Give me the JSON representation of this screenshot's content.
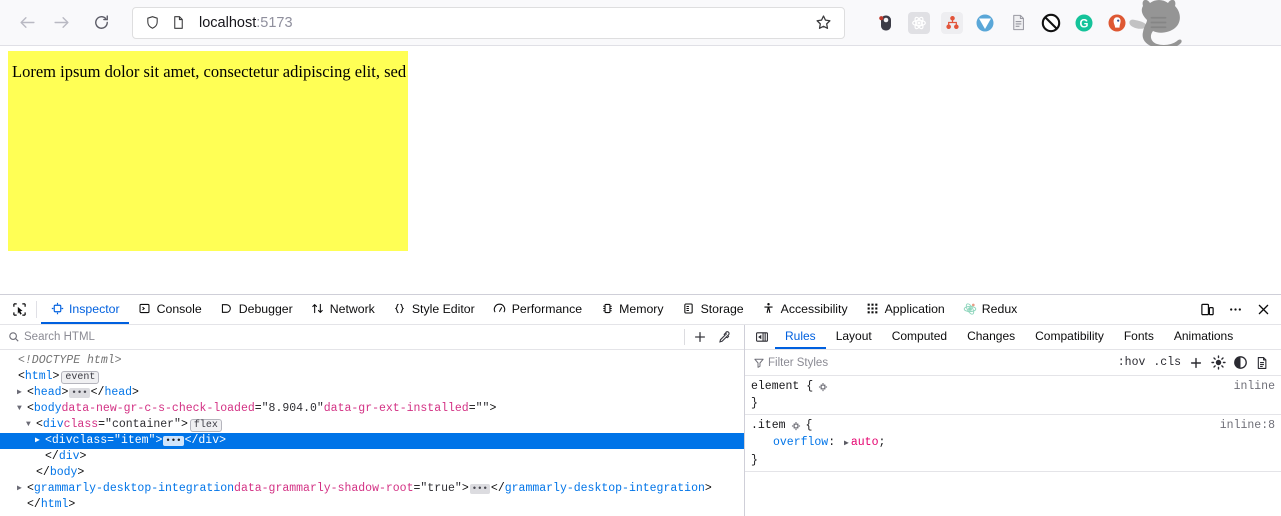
{
  "browser": {
    "nav": {
      "back_icon": "arrow-left-icon",
      "forward_icon": "arrow-right-icon",
      "reload_icon": "reload-icon"
    },
    "urlbar": {
      "shield_icon": "shield-icon",
      "page_icon": "page-icon",
      "url_host": "localhost",
      "url_port": ":5173",
      "full_url": "localhost:5173",
      "bookmark_icon": "star-icon"
    },
    "extensions": [
      {
        "name": "extension-dark-icon",
        "label": ""
      },
      {
        "name": "react-devtools-icon",
        "label": ""
      },
      {
        "name": "sitemap-icon",
        "label": ""
      },
      {
        "name": "vimium-icon",
        "label": ""
      },
      {
        "name": "document-reader-icon",
        "label": ""
      },
      {
        "name": "ublock-origin-icon",
        "label": ""
      },
      {
        "name": "grammarly-icon",
        "label": "G"
      },
      {
        "name": "duckduckgo-privacy-icon",
        "label": ""
      }
    ],
    "menu_icon": "hamburger-menu-icon",
    "cat_overlay": "cat-silhouette-overlay"
  },
  "page": {
    "item_text": "Lorem ipsum dolor sit amet, consectetur adipiscing elit, sed…",
    "container_color": "#ffff55"
  },
  "devtools": {
    "picker_icon": "element-picker-icon",
    "tabs": [
      {
        "label": "Inspector",
        "icon": "inspector-icon",
        "active": true
      },
      {
        "label": "Console",
        "icon": "console-icon",
        "active": false
      },
      {
        "label": "Debugger",
        "icon": "debugger-icon",
        "active": false
      },
      {
        "label": "Network",
        "icon": "network-icon",
        "active": false
      },
      {
        "label": "Style Editor",
        "icon": "style-editor-icon",
        "active": false
      },
      {
        "label": "Performance",
        "icon": "performance-icon",
        "active": false
      },
      {
        "label": "Memory",
        "icon": "memory-icon",
        "active": false
      },
      {
        "label": "Storage",
        "icon": "storage-icon",
        "active": false
      },
      {
        "label": "Accessibility",
        "icon": "accessibility-icon",
        "active": false
      },
      {
        "label": "Application",
        "icon": "application-icon",
        "active": false
      },
      {
        "label": "Redux",
        "icon": "redux-icon",
        "active": false
      }
    ],
    "toolbar_buttons": [
      {
        "name": "responsive-design-mode-icon"
      },
      {
        "name": "devtools-meatball-menu-icon"
      },
      {
        "name": "close-devtools-icon"
      }
    ],
    "markup": {
      "search_placeholder": "Search HTML",
      "search_icon": "search-icon",
      "add_node_icon": "plus-icon",
      "eyedropper_icon": "eyedropper-icon",
      "lines": [
        {
          "id": "doctype",
          "indent": 0,
          "twisty": "none",
          "selected": false,
          "parts": [
            {
              "t": "doctype",
              "s": "<!DOCTYPE html>"
            }
          ]
        },
        {
          "id": "html-open",
          "indent": 0,
          "twisty": "none",
          "selected": false,
          "parts": [
            {
              "t": "punc",
              "s": "<"
            },
            {
              "t": "tag",
              "s": "html"
            },
            {
              "t": "punc",
              "s": ">"
            },
            {
              "t": "badge",
              "s": "event"
            }
          ]
        },
        {
          "id": "head",
          "indent": 1,
          "twisty": "collapsed",
          "selected": false,
          "parts": [
            {
              "t": "punc",
              "s": "<"
            },
            {
              "t": "tag",
              "s": "head"
            },
            {
              "t": "punc",
              "s": ">"
            },
            {
              "t": "ellipsis",
              "s": ""
            },
            {
              "t": "punc",
              "s": "</"
            },
            {
              "t": "tag",
              "s": "head"
            },
            {
              "t": "punc",
              "s": ">"
            }
          ]
        },
        {
          "id": "body-open",
          "indent": 1,
          "twisty": "expanded",
          "selected": false,
          "parts": [
            {
              "t": "punc",
              "s": "<"
            },
            {
              "t": "tag",
              "s": "body"
            },
            {
              "t": "attr",
              "s": " data-new-gr-c-s-check-loaded"
            },
            {
              "t": "punc",
              "s": "="
            },
            {
              "t": "val",
              "s": "\"8.904.0\""
            },
            {
              "t": "attr",
              "s": " data-gr-ext-installed"
            },
            {
              "t": "punc",
              "s": "="
            },
            {
              "t": "val",
              "s": "\"\""
            },
            {
              "t": "punc",
              "s": ">"
            }
          ]
        },
        {
          "id": "container-open",
          "indent": 2,
          "twisty": "expanded",
          "selected": false,
          "parts": [
            {
              "t": "punc",
              "s": "<"
            },
            {
              "t": "tag",
              "s": "div"
            },
            {
              "t": "attr",
              "s": " class"
            },
            {
              "t": "punc",
              "s": "="
            },
            {
              "t": "val",
              "s": "\"container\""
            },
            {
              "t": "punc",
              "s": ">"
            },
            {
              "t": "badge",
              "s": "flex"
            }
          ]
        },
        {
          "id": "item",
          "indent": 3,
          "twisty": "collapsed",
          "selected": true,
          "parts": [
            {
              "t": "punc",
              "s": "<"
            },
            {
              "t": "tag",
              "s": "div"
            },
            {
              "t": "attr",
              "s": " class"
            },
            {
              "t": "punc",
              "s": "="
            },
            {
              "t": "val",
              "s": "\"item\""
            },
            {
              "t": "punc",
              "s": ">"
            },
            {
              "t": "ellipsis",
              "s": ""
            },
            {
              "t": "punc",
              "s": "</"
            },
            {
              "t": "tag",
              "s": "div"
            },
            {
              "t": "punc",
              "s": ">"
            }
          ]
        },
        {
          "id": "container-close",
          "indent": 3,
          "twisty": "none",
          "selected": false,
          "parts": [
            {
              "t": "punc",
              "s": "</"
            },
            {
              "t": "tag",
              "s": "div"
            },
            {
              "t": "punc",
              "s": ">"
            }
          ]
        },
        {
          "id": "body-close",
          "indent": 2,
          "twisty": "none",
          "selected": false,
          "parts": [
            {
              "t": "punc",
              "s": "</"
            },
            {
              "t": "tag",
              "s": "body"
            },
            {
              "t": "punc",
              "s": ">"
            }
          ]
        },
        {
          "id": "grammarly",
          "indent": 1,
          "twisty": "collapsed",
          "selected": false,
          "parts": [
            {
              "t": "punc",
              "s": "<"
            },
            {
              "t": "tag",
              "s": "grammarly-desktop-integration"
            },
            {
              "t": "attr",
              "s": " data-grammarly-shadow-root"
            },
            {
              "t": "punc",
              "s": "="
            },
            {
              "t": "val",
              "s": "\"true\""
            },
            {
              "t": "punc",
              "s": ">"
            },
            {
              "t": "ellipsis",
              "s": ""
            },
            {
              "t": "punc",
              "s": "</"
            },
            {
              "t": "tag",
              "s": "grammarly-desktop-integration"
            },
            {
              "t": "punc",
              "s": ">"
            }
          ]
        },
        {
          "id": "html-close",
          "indent": 1,
          "twisty": "none",
          "selected": false,
          "parts": [
            {
              "t": "punc",
              "s": "</"
            },
            {
              "t": "tag",
              "s": "html"
            },
            {
              "t": "punc",
              "s": ">"
            }
          ]
        }
      ]
    },
    "rules": {
      "sidebar_toggle_icon": "toggle-sidebar-icon",
      "tabs": [
        {
          "label": "Rules",
          "active": true
        },
        {
          "label": "Layout",
          "active": false
        },
        {
          "label": "Computed",
          "active": false
        },
        {
          "label": "Changes",
          "active": false
        },
        {
          "label": "Compatibility",
          "active": false
        },
        {
          "label": "Fonts",
          "active": false
        },
        {
          "label": "Animations",
          "active": false
        }
      ],
      "filter": {
        "icon": "filter-icon",
        "placeholder": "Filter Styles",
        "hov_label": ":hov",
        "cls_label": ".cls",
        "add_rule_icon": "plus-icon",
        "light_scheme_icon": "sun-icon",
        "dark_scheme_icon": "moon-icon",
        "print_media_icon": "print-preview-icon"
      },
      "blocks": [
        {
          "selector": "element {",
          "origin": "inline",
          "gear_icon": "toggle-pseudo-icon",
          "declarations": [],
          "close": "}"
        },
        {
          "selector": ".item",
          "origin": "inline:8",
          "gear_icon": "toggle-pseudo-icon",
          "open_brace": "{",
          "declarations": [
            {
              "property": "overflow",
              "value": "auto",
              "expandable": true
            }
          ],
          "close": "}"
        }
      ]
    }
  }
}
